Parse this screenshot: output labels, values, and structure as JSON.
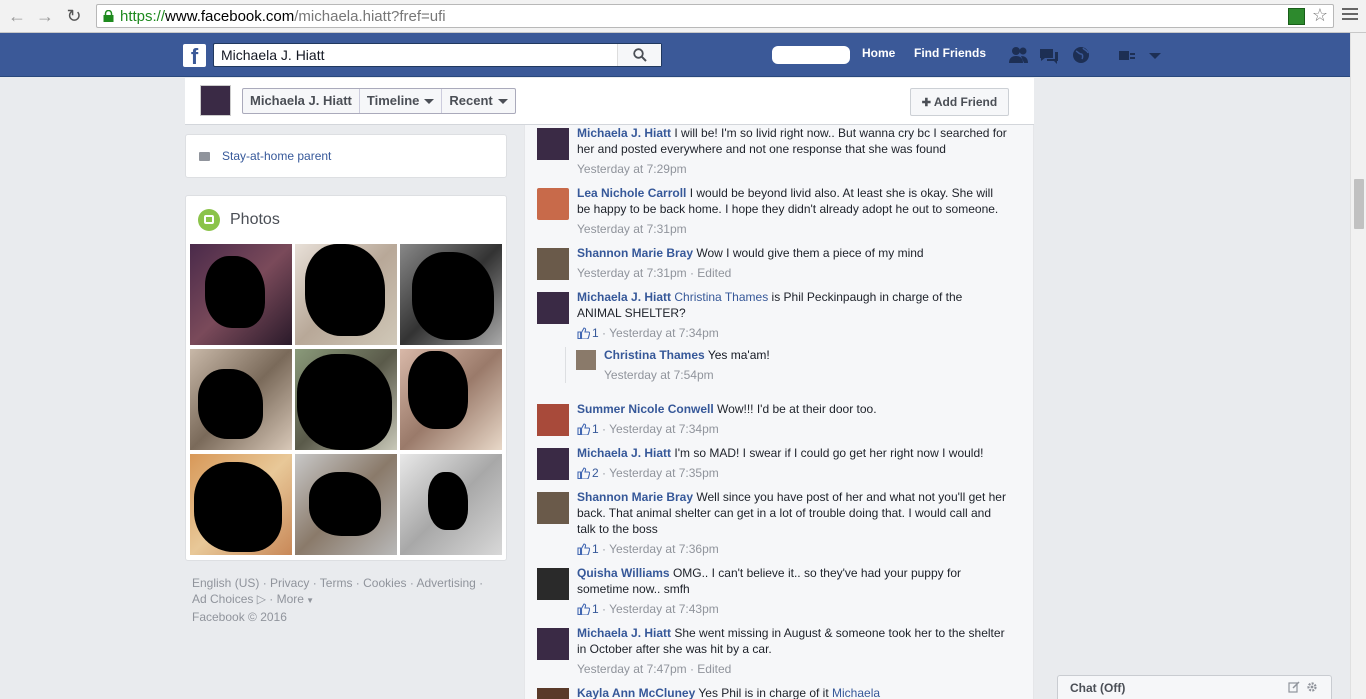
{
  "browser": {
    "url_scheme": "https://",
    "url_domain": "www.facebook.com",
    "url_path": "/michaela.hiatt?fref=ufi"
  },
  "topbar": {
    "search_value": "Michaela J. Hiatt",
    "home": "Home",
    "find_friends": "Find Friends"
  },
  "timeline_nav": {
    "name": "Michaela J. Hiatt",
    "timeline": "Timeline",
    "recent": "Recent",
    "add_friend": "Add Friend"
  },
  "intro": {
    "occupation": "Stay-at-home parent"
  },
  "photos": {
    "title": "Photos"
  },
  "footer": {
    "line1": "English (US) · Privacy · Terms · Cookies · Advertising ·",
    "line2a": "Ad Choices",
    "line2b": " · More",
    "line3": "Facebook © 2016"
  },
  "comments": [
    {
      "name": "Michaela J. Hiatt",
      "text": "I will be! I'm so livid right now.. But wanna cry bc I searched for her and posted everywhere and not one response that she was found",
      "meta": "Yesterday at 7:29pm"
    },
    {
      "name": "Lea Nichole Carroll",
      "text": "I would be beyond livid also. At least she is okay. She will be happy to be back home. I hope they didn't already adopt he out to someone.",
      "meta": "Yesterday at 7:31pm"
    },
    {
      "name": "Shannon Marie Bray",
      "text": "Wow I would give them a piece of my mind",
      "meta": "Yesterday at 7:31pm · Edited"
    },
    {
      "name": "Michaela J. Hiatt",
      "mention": "Christina Thames",
      "text": "is Phil Peckinpaugh in charge of the ANIMAL SHELTER?",
      "likes": "1",
      "meta": "Yesterday at 7:34pm"
    },
    {
      "name": "Christina Thames",
      "text": "Yes ma'am!",
      "meta": "Yesterday at 7:54pm"
    },
    {
      "name": "Summer Nicole Conwell",
      "text": "Wow!!! I'd be at their door too.",
      "likes": "1",
      "meta": "Yesterday at 7:34pm"
    },
    {
      "name": "Michaela J. Hiatt",
      "text": "I'm so MAD! I swear if I could go get her right now I would!",
      "likes": "2",
      "meta": "Yesterday at 7:35pm"
    },
    {
      "name": "Shannon Marie Bray",
      "text": "Well since you have post of her and what not you'll get her back. That animal shelter can get in a lot of trouble doing that. I would call and talk to the boss",
      "likes": "1",
      "meta": "Yesterday at 7:36pm"
    },
    {
      "name": "Quisha Williams",
      "text": "OMG.. I can't believe it.. so they've had your puppy for sometime now.. smfh",
      "likes": "1",
      "meta": "Yesterday at 7:43pm"
    },
    {
      "name": "Michaela J. Hiatt",
      "text": "She went missing in August & someone took her to the shelter in October after she was hit by a car.",
      "meta": "Yesterday at 7:47pm · Edited"
    },
    {
      "name": "Kayla Ann McCluney",
      "text": "Yes Phil is in charge of it",
      "mention": "Michaela"
    }
  ],
  "chat": {
    "label": "Chat (Off)"
  },
  "colors": {
    "fb_blue": "#3b5998",
    "link": "#365899",
    "meta": "#90949c"
  }
}
